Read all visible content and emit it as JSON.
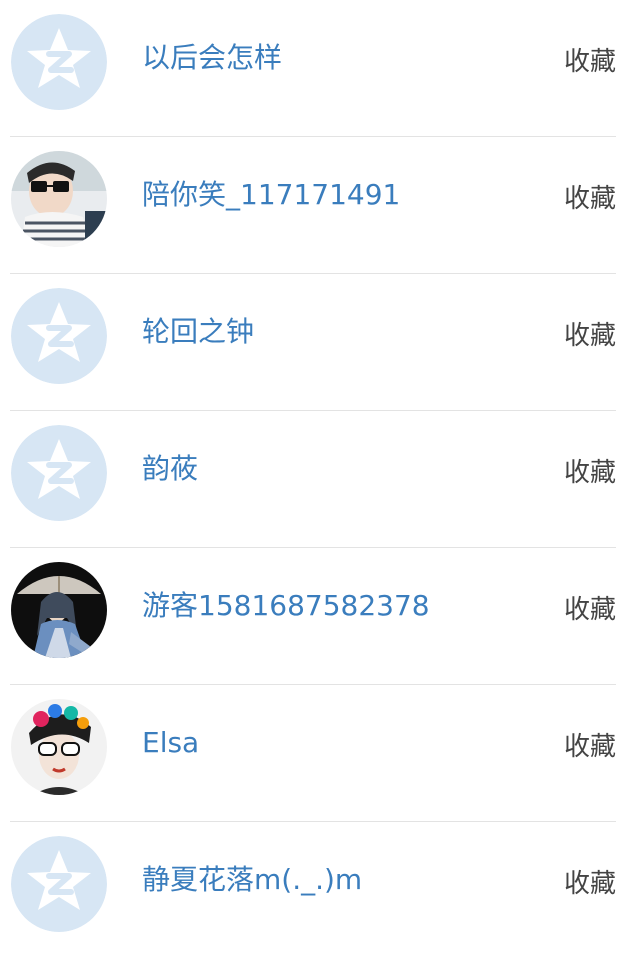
{
  "favorite_label": "收藏",
  "items": [
    {
      "name": "以后会怎样",
      "avatar": "default-avatar-icon"
    },
    {
      "name": "陪你笑_117171491",
      "avatar": "user-photo-avatar"
    },
    {
      "name": "轮回之钟",
      "avatar": "default-avatar-icon"
    },
    {
      "name": "韵莜",
      "avatar": "default-avatar-icon"
    },
    {
      "name": "游客1581687582378",
      "avatar": "user-photo-avatar"
    },
    {
      "name": "Elsa",
      "avatar": "user-photo-avatar"
    },
    {
      "name": "静夏花落m(._.)m",
      "avatar": "default-avatar-icon"
    }
  ],
  "colors": {
    "name": "#3a7dbd",
    "favorite": "#444444",
    "divider": "#e3e3e3",
    "default_avatar_bg": "#d7e6f4"
  }
}
